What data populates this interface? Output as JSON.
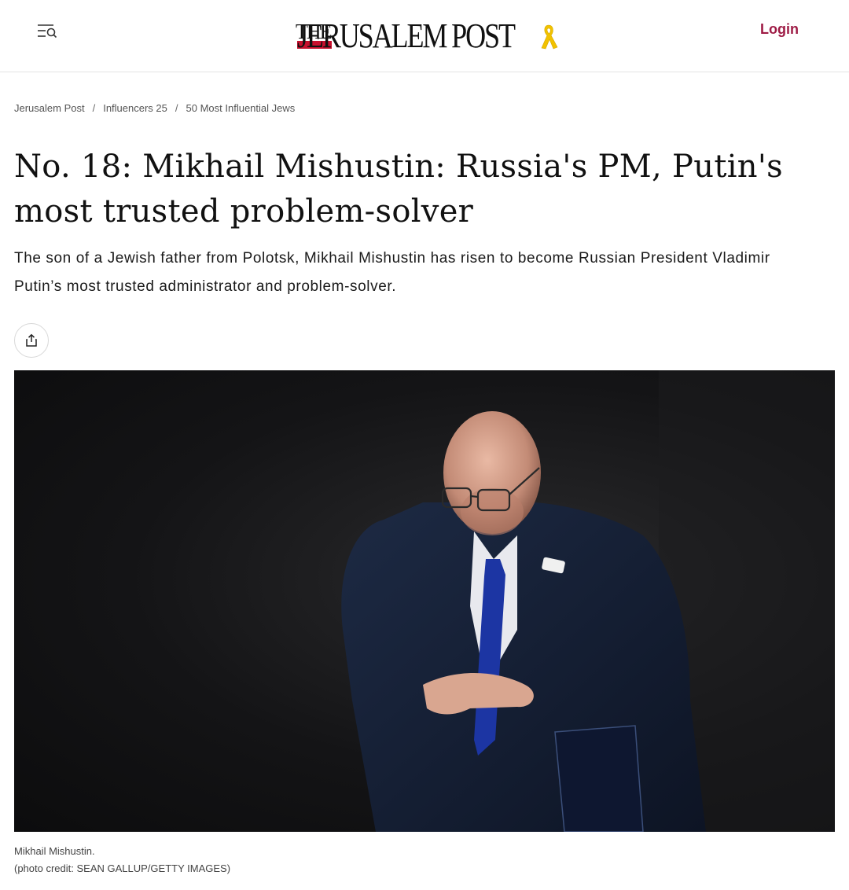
{
  "header": {
    "menu_icon": "menu-search-icon",
    "logo_the": "THE",
    "logo_name": "JERUSALEM POST",
    "logo_ribbon_icon": "yellow-ribbon-icon",
    "login_label": "Login",
    "login_color": "#9e1b45"
  },
  "breadcrumb": {
    "items": [
      "Jerusalem Post",
      "Influencers 25",
      "50 Most Influential Jews"
    ],
    "separator": "/"
  },
  "article": {
    "headline": "No. 18: Mikhail Mishustin: Russia's PM, Putin's most trusted problem-solver",
    "subhead": "The son of a Jewish father from Polotsk, Mikhail Mishustin has risen to become Russian President Vladimir Putin’s most trusted administrator and problem-solver.",
    "share_icon": "share-icon"
  },
  "photo": {
    "caption": "Mikhail Mishustin.",
    "credit": "(photo credit: SEAN GALLUP/GETTY IMAGES)"
  }
}
